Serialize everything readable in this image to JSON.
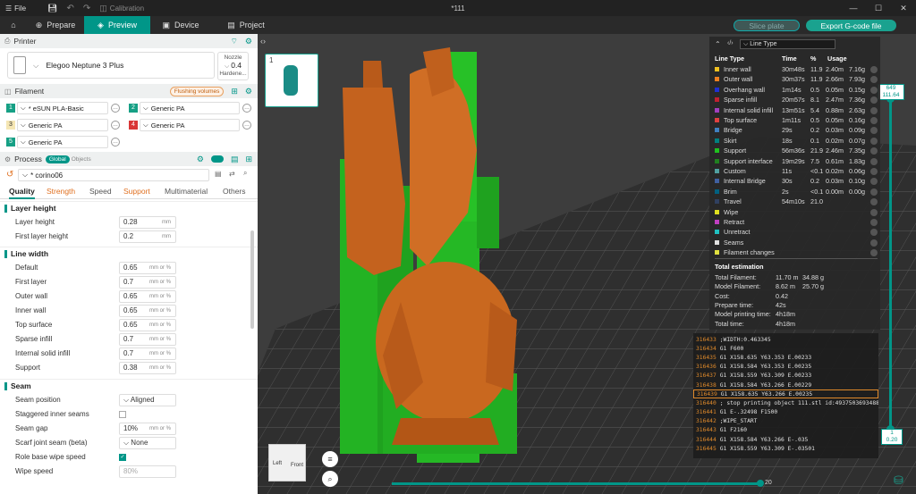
{
  "titlebar": {
    "menu_file": "File",
    "calibration": "Calibration",
    "doc_title": "*111"
  },
  "tabs": [
    {
      "label": "Prepare"
    },
    {
      "label": "Preview"
    },
    {
      "label": "Device"
    },
    {
      "label": "Project"
    }
  ],
  "toolbar": {
    "slice_label": "Slice plate",
    "export_label": "Export G-code file"
  },
  "printer": {
    "section": "Printer",
    "name": "Elegoo Neptune 3 Plus",
    "nozzle_label": "Nozzle",
    "nozzle_value": "0.4",
    "nozzle_type": "Hardene..."
  },
  "filament": {
    "section": "Filament",
    "flush_label": "Flushing volumes",
    "slots": [
      {
        "num": "1",
        "name": "* eSUN PLA-Basic",
        "color": "#16a085"
      },
      {
        "num": "2",
        "name": "Generic PA",
        "color": "#16a085"
      },
      {
        "num": "3",
        "name": "Generic PA",
        "color": "#f5e6b3"
      },
      {
        "num": "4",
        "name": "Generic PA",
        "color": "#d93636"
      },
      {
        "num": "5",
        "name": "Generic PA",
        "color": "#16a085"
      }
    ]
  },
  "process": {
    "section": "Process",
    "global_label": "Global",
    "objects_label": "Objects",
    "preset": "* corino06",
    "tabs": [
      "Quality",
      "Strength",
      "Speed",
      "Support",
      "Multimaterial",
      "Others"
    ]
  },
  "settings": {
    "layer_height_group": "Layer height",
    "layer_height": {
      "label": "Layer height",
      "value": "0.28",
      "unit": "mm"
    },
    "first_layer_height": {
      "label": "First layer height",
      "value": "0.2",
      "unit": "mm"
    },
    "line_width_group": "Line width",
    "widths": [
      {
        "label": "Default",
        "value": "0.65",
        "unit": "mm or %"
      },
      {
        "label": "First layer",
        "value": "0.7",
        "unit": "mm or %"
      },
      {
        "label": "Outer wall",
        "value": "0.65",
        "unit": "mm or %"
      },
      {
        "label": "Inner wall",
        "value": "0.65",
        "unit": "mm or %"
      },
      {
        "label": "Top surface",
        "value": "0.65",
        "unit": "mm or %"
      },
      {
        "label": "Sparse infill",
        "value": "0.7",
        "unit": "mm or %"
      },
      {
        "label": "Internal solid infill",
        "value": "0.7",
        "unit": "mm or %"
      },
      {
        "label": "Support",
        "value": "0.38",
        "unit": "mm or %"
      }
    ],
    "seam_group": "Seam",
    "seam_position": {
      "label": "Seam position",
      "value": "Aligned"
    },
    "staggered": {
      "label": "Staggered inner seams"
    },
    "seam_gap": {
      "label": "Seam gap",
      "value": "10%",
      "unit": "mm or %"
    },
    "scarf": {
      "label": "Scarf joint seam (beta)",
      "value": "None"
    },
    "role_wipe": {
      "label": "Role base wipe speed"
    },
    "wipe_speed": {
      "label": "Wipe speed",
      "value": "80%"
    }
  },
  "plate": {
    "number": "1"
  },
  "cube": {
    "left": "Left",
    "front": "Front"
  },
  "stats": {
    "header": "Line Type",
    "columns": [
      "Line Type",
      "Time",
      "%",
      "Usage"
    ],
    "rows": [
      {
        "name": "Inner wall",
        "time": "30m48s",
        "pct": "11.9",
        "len": "2.40m",
        "wt": "7.16g",
        "color": "#f0c020"
      },
      {
        "name": "Outer wall",
        "time": "30m37s",
        "pct": "11.9",
        "len": "2.66m",
        "wt": "7.93g",
        "color": "#f08020"
      },
      {
        "name": "Overhang wall",
        "time": "1m14s",
        "pct": "0.5",
        "len": "0.05m",
        "wt": "0.15g",
        "color": "#2030d0"
      },
      {
        "name": "Sparse infill",
        "time": "20m57s",
        "pct": "8.1",
        "len": "2.47m",
        "wt": "7.36g",
        "color": "#c02030"
      },
      {
        "name": "Internal solid infill",
        "time": "13m51s",
        "pct": "5.4",
        "len": "0.88m",
        "wt": "2.63g",
        "color": "#a040c0"
      },
      {
        "name": "Top surface",
        "time": "1m11s",
        "pct": "0.5",
        "len": "0.05m",
        "wt": "0.16g",
        "color": "#e04040"
      },
      {
        "name": "Bridge",
        "time": "29s",
        "pct": "0.2",
        "len": "0.03m",
        "wt": "0.09g",
        "color": "#4080c0"
      },
      {
        "name": "Skirt",
        "time": "18s",
        "pct": "0.1",
        "len": "0.02m",
        "wt": "0.07g",
        "color": "#008080"
      },
      {
        "name": "Support",
        "time": "56m36s",
        "pct": "21.9",
        "len": "2.46m",
        "wt": "7.35g",
        "color": "#20c020"
      },
      {
        "name": "Support interface",
        "time": "19m29s",
        "pct": "7.5",
        "len": "0.61m",
        "wt": "1.83g",
        "color": "#208020"
      },
      {
        "name": "Custom",
        "time": "11s",
        "pct": "<0.1",
        "len": "0.02m",
        "wt": "0.06g",
        "color": "#50a0a0"
      },
      {
        "name": "Internal Bridge",
        "time": "30s",
        "pct": "0.2",
        "len": "0.03m",
        "wt": "0.10g",
        "color": "#4060a0"
      },
      {
        "name": "Brim",
        "time": "2s",
        "pct": "<0.1",
        "len": "0.00m",
        "wt": "0.00g",
        "color": "#006080"
      },
      {
        "name": "Travel",
        "time": "54m10s",
        "pct": "21.0",
        "len": "",
        "wt": "",
        "color": "#304060"
      },
      {
        "name": "Wipe",
        "time": "",
        "pct": "",
        "len": "",
        "wt": "",
        "color": "#e0e020"
      },
      {
        "name": "Retract",
        "time": "",
        "pct": "",
        "len": "",
        "wt": "",
        "color": "#c040c0"
      },
      {
        "name": "Unretract",
        "time": "",
        "pct": "",
        "len": "",
        "wt": "",
        "color": "#20c0c0"
      },
      {
        "name": "Seams",
        "time": "",
        "pct": "",
        "len": "",
        "wt": "",
        "color": "#e0e0e0"
      },
      {
        "name": "Filament changes",
        "time": "",
        "pct": "",
        "len": "",
        "wt": "",
        "color": "#e0e040"
      }
    ],
    "total_label": "Total estimation",
    "totals": [
      {
        "label": "Total Filament:",
        "v1": "11.70 m",
        "v2": "34.88 g"
      },
      {
        "label": "Model Filament:",
        "v1": "8.62 m",
        "v2": "25.70 g"
      },
      {
        "label": "Cost:",
        "v1": "0.42",
        "v2": ""
      },
      {
        "label": "Prepare time:",
        "v1": "42s",
        "v2": ""
      },
      {
        "label": "Model printing time:",
        "v1": "4h18m",
        "v2": ""
      },
      {
        "label": "Total time:",
        "v1": "4h18m",
        "v2": ""
      }
    ]
  },
  "gcode": [
    {
      "n": "316433",
      "t": ";WIDTH:0.463345"
    },
    {
      "n": "316434",
      "t": "G1 F600"
    },
    {
      "n": "316435",
      "t": "G1 X158.635 Y63.353 E.00233"
    },
    {
      "n": "316436",
      "t": "G1 X158.584 Y63.353 E.00235"
    },
    {
      "n": "316437",
      "t": "G1 X158.559 Y63.309 E.00233"
    },
    {
      "n": "316438",
      "t": "G1 X158.584 Y63.266 E.00229"
    },
    {
      "n": "316439",
      "t": "G1 X158.635 Y63.266 E.00235"
    },
    {
      "n": "316440",
      "t": "; stop printing object 111.stl id:49375036934880353"
    },
    {
      "n": "316441",
      "t": "G1 E-.32498 F1500"
    },
    {
      "n": "316442",
      "t": ";WIPE_START"
    },
    {
      "n": "316443",
      "t": "G1 F2160"
    },
    {
      "n": "316444",
      "t": "G1 X158.584 Y63.266 E-.035"
    },
    {
      "n": "316445",
      "t": "G1 X158.559 Y63.309 E-.03501"
    }
  ],
  "layers": {
    "top_layer": "649",
    "top_height": "111.64",
    "bottom_layer": "1",
    "bottom_height": "0.20"
  },
  "moves": {
    "value": "20"
  }
}
